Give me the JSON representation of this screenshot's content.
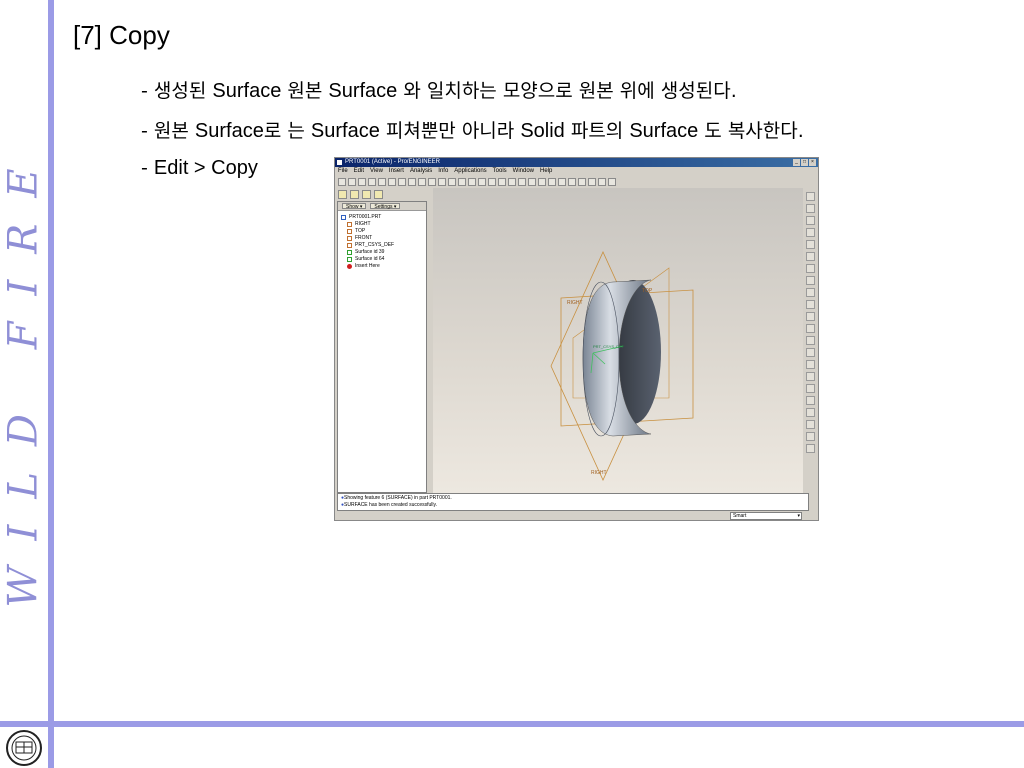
{
  "slide": {
    "title": "[7] Copy",
    "side_title": "WILD FIRE",
    "bullets": [
      {
        "dash": "- ",
        "parts": [
          "생성된 ",
          "Surface",
          " 원본 ",
          "Surface",
          " 와 일치하는 모양으로 원본 위에 생성된다."
        ]
      },
      {
        "dash": "- ",
        "parts": [
          "원본 ",
          "Surface",
          "로 는 ",
          "Surface",
          " 피쳐뿐만 아니라 ",
          "Solid",
          " 파트의 ",
          "Surface",
          " 도 복사한다."
        ]
      },
      {
        "dash": "- ",
        "parts": [
          "Edit > Copy"
        ]
      }
    ]
  },
  "app": {
    "window_title": "PRT0001 (Active) - Pro/ENGINEER",
    "menu": [
      "File",
      "Edit",
      "View",
      "Insert",
      "Analysis",
      "Info",
      "Applications",
      "Tools",
      "Window",
      "Help"
    ],
    "tree_tabs": [
      "Show ▾",
      "Settings ▾"
    ],
    "tree_items": [
      {
        "label": "PRT0001.PRT",
        "kind": "root"
      },
      {
        "label": "RIGHT",
        "kind": "plane"
      },
      {
        "label": "TOP",
        "kind": "plane"
      },
      {
        "label": "FRONT",
        "kind": "plane"
      },
      {
        "label": "PRT_CSYS_DEF",
        "kind": "csys"
      },
      {
        "label": "Surface id 39",
        "kind": "surf"
      },
      {
        "label": "Surface id 64",
        "kind": "surf"
      },
      {
        "label": "Insert Here",
        "kind": "insert"
      }
    ],
    "viewport_labels": {
      "right_top": "RIGHT",
      "top": "TOP",
      "right_bottom": "RIGHT",
      "csys": "PRT_CSYS_DEF"
    },
    "messages": [
      "Showing feature 6 (SURFACE) in part PRT0001.",
      "SURFACE has been created successfully."
    ],
    "status_filter": "Smart"
  }
}
